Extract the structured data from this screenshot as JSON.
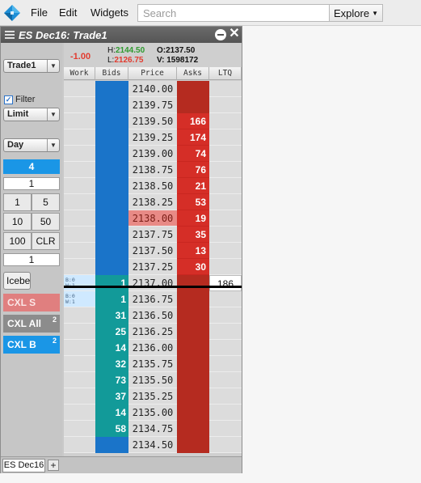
{
  "menu": {
    "items": [
      "File",
      "Edit",
      "Widgets"
    ],
    "search_placeholder": "Search",
    "explore_label": "Explore"
  },
  "widget": {
    "title": "ES Dec16: Trade1",
    "close_glyph": "✕"
  },
  "controls": {
    "account": "Trade1",
    "filter_label": "Filter",
    "filter_checked": true,
    "order_type": "Limit",
    "tif": "Day",
    "account_number": "4",
    "qty_top": "1",
    "quick_qty": [
      "1",
      "5",
      "10",
      "50",
      "100",
      "CLR"
    ],
    "qty_bottom": "1",
    "iceberg_label": "Icebe",
    "cxl_sell": {
      "label": "CXL S"
    },
    "cxl_all": {
      "label": "CXL All",
      "count": "2"
    },
    "cxl_buy": {
      "label": "CXL B",
      "count": "2"
    }
  },
  "ladder": {
    "net_change": "-1.00",
    "high_label": "H:",
    "high": "2144.50",
    "low_label": "L:",
    "low": "2126.75",
    "open": "O:2137.50",
    "volume": "V: 1598172",
    "columns": [
      "Work",
      "Bids",
      "Price",
      "Asks",
      "LTQ"
    ],
    "last_trade_price": "2138.00",
    "last_trade_qty": "186",
    "rows": [
      {
        "price": "2140.00",
        "bid": "",
        "ask": "",
        "ltq": "",
        "work": ""
      },
      {
        "price": "2139.75",
        "bid": "",
        "ask": "",
        "ltq": "",
        "work": ""
      },
      {
        "price": "2139.50",
        "bid": "",
        "ask": "166",
        "ltq": "",
        "work": ""
      },
      {
        "price": "2139.25",
        "bid": "",
        "ask": "174",
        "ltq": "",
        "work": ""
      },
      {
        "price": "2139.00",
        "bid": "",
        "ask": "74",
        "ltq": "",
        "work": ""
      },
      {
        "price": "2138.75",
        "bid": "",
        "ask": "76",
        "ltq": "",
        "work": ""
      },
      {
        "price": "2138.50",
        "bid": "",
        "ask": "21",
        "ltq": "",
        "work": ""
      },
      {
        "price": "2138.25",
        "bid": "",
        "ask": "53",
        "ltq": "",
        "work": ""
      },
      {
        "price": "2138.00",
        "bid": "",
        "ask": "19",
        "ltq": "",
        "work": ""
      },
      {
        "price": "2137.75",
        "bid": "",
        "ask": "35",
        "ltq": "",
        "work": ""
      },
      {
        "price": "2137.50",
        "bid": "",
        "ask": "13",
        "ltq": "",
        "work": ""
      },
      {
        "price": "2137.25",
        "bid": "",
        "ask": "30",
        "ltq": "",
        "work": ""
      },
      {
        "price": "2137.00",
        "bid": "1",
        "ask": "",
        "ltq": "186",
        "work": "B:0\nW:1"
      },
      {
        "price": "2136.75",
        "bid": "1",
        "ask": "",
        "ltq": "",
        "work": "B:0\nW:1"
      },
      {
        "price": "2136.50",
        "bid": "31",
        "ask": "",
        "ltq": "",
        "work": ""
      },
      {
        "price": "2136.25",
        "bid": "25",
        "ask": "",
        "ltq": "",
        "work": ""
      },
      {
        "price": "2136.00",
        "bid": "14",
        "ask": "",
        "ltq": "",
        "work": ""
      },
      {
        "price": "2135.75",
        "bid": "32",
        "ask": "",
        "ltq": "",
        "work": ""
      },
      {
        "price": "2135.50",
        "bid": "73",
        "ask": "",
        "ltq": "",
        "work": ""
      },
      {
        "price": "2135.25",
        "bid": "37",
        "ask": "",
        "ltq": "",
        "work": ""
      },
      {
        "price": "2135.00",
        "bid": "14",
        "ask": "",
        "ltq": "",
        "work": ""
      },
      {
        "price": "2134.75",
        "bid": "58",
        "ask": "",
        "ltq": "",
        "work": ""
      },
      {
        "price": "2134.50",
        "bid": "",
        "ask": "",
        "ltq": "",
        "work": ""
      }
    ]
  },
  "tabs": {
    "items": [
      "ES Dec16"
    ],
    "add_glyph": "+"
  },
  "colors": {
    "bid_empty": "#1a74c9",
    "bid_level": "#129a99",
    "ask_empty": "#b52b20",
    "ask_level": "#d52e27",
    "account_blue": "#1a96e6",
    "cxl_sell": "#e07f7f",
    "cxl_all": "#8c8c8c",
    "cxl_buy": "#1a96e6"
  }
}
